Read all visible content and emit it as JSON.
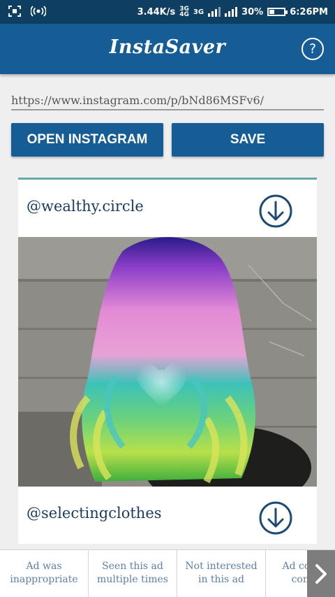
{
  "status_bar": {
    "speed": "3.44K/s",
    "network": "3G",
    "battery": "30%",
    "time": "6:26PM"
  },
  "app": {
    "title": "InstaSaver",
    "help_label": "?"
  },
  "url_input": {
    "value": "https://www.instagram.com/p/bNd86MSFv6/"
  },
  "buttons": {
    "open_instagram": "OPEN INSTAGRAM",
    "save": "SAVE"
  },
  "posts": [
    {
      "username": "@wealthy.circle"
    },
    {
      "username": "@selectingclothes"
    }
  ],
  "ad_feedback": {
    "options": [
      {
        "line1": "Ad was",
        "line2": "inappropriate"
      },
      {
        "line1": "Seen this ad",
        "line2": "multiple times"
      },
      {
        "line1": "Not interested",
        "line2": "in this ad"
      },
      {
        "line1": "Ad covered",
        "line2": "content"
      }
    ],
    "next_icon": "chevron-right-icon"
  },
  "colors": {
    "status_bar": "#0e3e62",
    "app_bar": "#175d95",
    "button": "#175d95",
    "username": "#1a3b5e"
  }
}
